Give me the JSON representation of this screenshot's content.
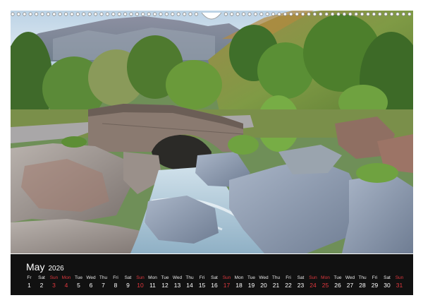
{
  "calendar": {
    "month": "May",
    "year": "2026",
    "weekend_color": "#e0383e",
    "days": [
      {
        "dow": "Fr",
        "date": "1",
        "weekend": false
      },
      {
        "dow": "Sat",
        "date": "2",
        "weekend": false
      },
      {
        "dow": "Sun",
        "date": "3",
        "weekend": true
      },
      {
        "dow": "Mon",
        "date": "4",
        "weekend": true
      },
      {
        "dow": "Tue",
        "date": "5",
        "weekend": false
      },
      {
        "dow": "Wed",
        "date": "6",
        "weekend": false
      },
      {
        "dow": "Thu",
        "date": "7",
        "weekend": false
      },
      {
        "dow": "Fri",
        "date": "8",
        "weekend": false
      },
      {
        "dow": "Sat",
        "date": "9",
        "weekend": false
      },
      {
        "dow": "Sun",
        "date": "10",
        "weekend": true
      },
      {
        "dow": "Mon",
        "date": "11",
        "weekend": false
      },
      {
        "dow": "Tue",
        "date": "12",
        "weekend": false
      },
      {
        "dow": "Wed",
        "date": "13",
        "weekend": false
      },
      {
        "dow": "Thu",
        "date": "14",
        "weekend": false
      },
      {
        "dow": "Fri",
        "date": "15",
        "weekend": false
      },
      {
        "dow": "Sat",
        "date": "16",
        "weekend": false
      },
      {
        "dow": "Sun",
        "date": "17",
        "weekend": true
      },
      {
        "dow": "Mon",
        "date": "18",
        "weekend": false
      },
      {
        "dow": "Tue",
        "date": "19",
        "weekend": false
      },
      {
        "dow": "Wed",
        "date": "20",
        "weekend": false
      },
      {
        "dow": "Thu",
        "date": "21",
        "weekend": false
      },
      {
        "dow": "Fri",
        "date": "22",
        "weekend": false
      },
      {
        "dow": "Sat",
        "date": "23",
        "weekend": false
      },
      {
        "dow": "Sun",
        "date": "24",
        "weekend": true
      },
      {
        "dow": "Mon",
        "date": "25",
        "weekend": true
      },
      {
        "dow": "Tue",
        "date": "26",
        "weekend": false
      },
      {
        "dow": "Wed",
        "date": "27",
        "weekend": false
      },
      {
        "dow": "Thu",
        "date": "28",
        "weekend": false
      },
      {
        "dow": "Fri",
        "date": "29",
        "weekend": false
      },
      {
        "dow": "Sat",
        "date": "30",
        "weekend": false
      },
      {
        "dow": "Sun",
        "date": "31",
        "weekend": true
      }
    ]
  }
}
